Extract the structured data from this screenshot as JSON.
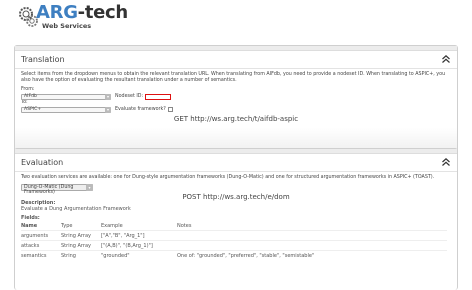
{
  "header": {
    "brand_arg": "ARG",
    "brand_tech": "-tech",
    "subtitle": "Web Services"
  },
  "translation": {
    "title": "Translation",
    "description": "Select items from the dropdown menus to obtain the relevant translation URL. When translating from AIFdb, you need to provide a nodeset ID. When translating to ASPIC+, you also have the option of evaluating the resultant translation under a number of semantics.",
    "from_label": "From:",
    "from_value": "AIFdb",
    "nodeset_label": "Nodeset ID:",
    "to_label": "To:",
    "to_value": "ASPIC+",
    "evaluate_label": "Evaluate framework?",
    "url": "GET http://ws.arg.tech/t/aifdb-aspic"
  },
  "evaluation": {
    "title": "Evaluation",
    "description": "Two evaluation services are available: one for Dung-style argumentation frameworks (Dung-O-Matic) and one for structured argumentation frameworks in ASPIC+ (TOAST).",
    "select_value": "Dung-O-Matic (Dung Frameworks)",
    "url": "POST http://ws.arg.tech/e/dom",
    "desc_heading": "Description:",
    "desc_text": "Evaluate a Dung Argumentation Framework",
    "fields_heading": "Fields:",
    "columns": [
      "Name",
      "Type",
      "Example",
      "Notes"
    ],
    "rows": [
      [
        "arguments",
        "String Array",
        "[\"A\",\"B\", \"Arg_1\"]",
        ""
      ],
      [
        "attacks",
        "String Array",
        "[\"(A,B)\", \"(B,Arg_1)\"]",
        ""
      ],
      [
        "semantics",
        "String",
        "\"grounded\"",
        "One of: \"grounded\", \"preferred\", \"stable\", \"semistable\""
      ]
    ]
  }
}
